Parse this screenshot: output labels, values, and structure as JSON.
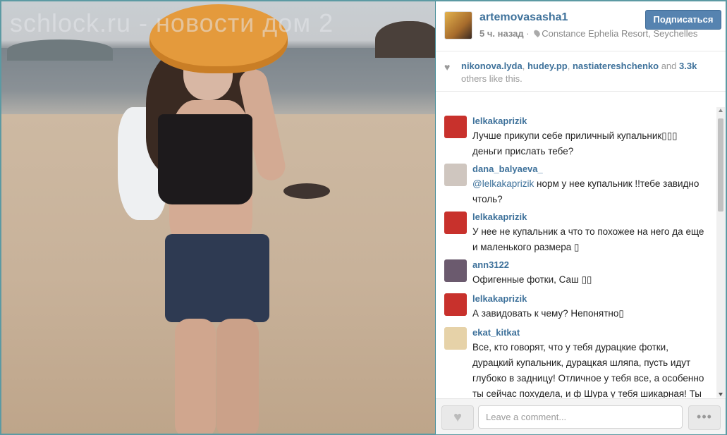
{
  "watermark": "schlock.ru - новости дом 2",
  "post": {
    "username": "artemovasasha1",
    "time": "5 ч. назад",
    "location": "Constance Ephelia Resort, Seychelles",
    "follow_label": "Подписаться"
  },
  "likes": {
    "users": [
      "nikonova.lyda",
      "hudey.pp",
      "nastiatereshchenko"
    ],
    "sep1": ", ",
    "sep2": ", ",
    "and_text": " and ",
    "count": "3.3k",
    "tail": "others like this."
  },
  "comments": [
    {
      "user": "lelkakaprizik",
      "text": "Лучше прикупи себе приличный купальник▯▯▯ деньги прислать тебе?",
      "avatar_color": "#c8312c"
    },
    {
      "user": "dana_balyaeva_",
      "mention": "@lelkakaprizik",
      "text": " норм у нее купальник !!тебе завидно чтоль?",
      "avatar_color": "#cfc6bf"
    },
    {
      "user": "lelkakaprizik",
      "text": "У нее не купальник а что то похожее на него да еще и маленького размера ▯",
      "avatar_color": "#c8312c"
    },
    {
      "user": "ann3122",
      "text": "Офигенные фотки, Саш ▯▯",
      "avatar_color": "#6b5a6e"
    },
    {
      "user": "lelkakaprizik",
      "text": "А завидовать к чему? Непонятно▯",
      "avatar_color": "#c8312c"
    },
    {
      "user": "ekat_kitkat",
      "text": "Все, кто говорят, что у тебя дурацкие фотки, дурацкий купальник, дурацкая шляпа, пусть идут глубоко в задницу! Отличное у тебя все, а особенно ты сейчас похудела, и ф Шура у тебя шикарная! Ты",
      "avatar_color": "#e6d2a8"
    }
  ],
  "footer": {
    "comment_placeholder": "Leave a comment...",
    "more_label": "•••"
  },
  "icons": {
    "heart": "heart-icon",
    "location": "map-pin-icon",
    "more": "more-dots-icon"
  },
  "colors": {
    "link": "#3f729b",
    "follow_button": "#5683b0"
  }
}
